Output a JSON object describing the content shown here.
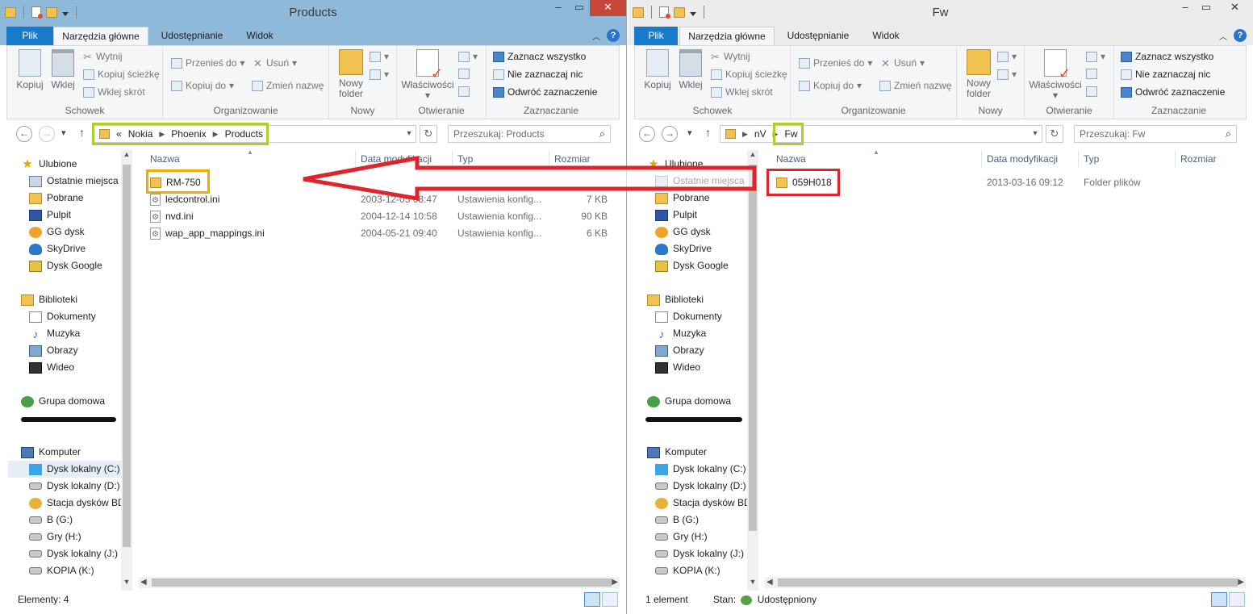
{
  "common": {
    "tabs": {
      "file": "Plik",
      "home": "Narzędzia główne",
      "share": "Udostępnianie",
      "view": "Widok"
    },
    "ribbon": {
      "clipboard": {
        "copy": "Kopiuj",
        "paste": "Wklej",
        "cut": "Wytnij",
        "copy_path": "Kopiuj ścieżkę",
        "paste_shortcut": "Wklej skrót",
        "label": "Schowek"
      },
      "organize": {
        "move_to": "Przenieś do",
        "copy_to": "Kopiuj do",
        "delete": "Usuń",
        "rename": "Zmień nazwę",
        "label": "Organizowanie"
      },
      "new": {
        "new_folder_line1": "Nowy",
        "new_folder_line2": "folder",
        "label": "Nowy"
      },
      "open": {
        "properties": "Właściwości",
        "label": "Otwieranie"
      },
      "select": {
        "select_all": "Zaznacz wszystko",
        "select_none": "Nie zaznaczaj nic",
        "invert": "Odwróć zaznaczenie",
        "label": "Zaznaczanie"
      }
    },
    "columns": {
      "name": "Nazwa",
      "date": "Data modyfikacji",
      "type": "Typ",
      "size": "Rozmiar"
    },
    "nav": {
      "favorites": "Ulubione",
      "recent": "Ostatnie miejsca",
      "downloads": "Pobrane",
      "desktop": "Pulpit",
      "gg": "GG dysk",
      "skydrive": "SkyDrive",
      "gdrive": "Dysk Google",
      "libraries": "Biblioteki",
      "documents": "Dokumenty",
      "music": "Muzyka",
      "pictures": "Obrazy",
      "video": "Wideo",
      "homegroup": "Grupa domowa",
      "computer": "Komputer",
      "drive_c": "Dysk lokalny (C:)",
      "drive_d": "Dysk lokalny (D:)",
      "drive_bd": "Stacja dysków BD",
      "drive_g": "B (G:)",
      "drive_h": "Gry (H:)",
      "drive_j": "Dysk lokalny (J:)",
      "drive_k": "KOPIA (K:)"
    }
  },
  "left": {
    "title": "Products",
    "breadcrumb_prefix": "«",
    "breadcrumb": [
      "Nokia",
      "Phoenix",
      "Products"
    ],
    "search_placeholder": "Przeszukaj: Products",
    "files": [
      {
        "name": "RM-750",
        "date": "",
        "type": "",
        "size": "",
        "icon": "folder"
      },
      {
        "name": "ledcontrol.ini",
        "date": "2003-12-05 08:47",
        "type": "Ustawienia konfig...",
        "size": "7 KB",
        "icon": "ini"
      },
      {
        "name": "nvd.ini",
        "date": "2004-12-14 10:58",
        "type": "Ustawienia konfig...",
        "size": "90 KB",
        "icon": "ini"
      },
      {
        "name": "wap_app_mappings.ini",
        "date": "2004-05-21 09:40",
        "type": "Ustawienia konfig...",
        "size": "6 KB",
        "icon": "ini"
      }
    ],
    "status": "Elementy: 4"
  },
  "right": {
    "title": "Fw",
    "breadcrumb": [
      "nV",
      "Fw"
    ],
    "search_placeholder": "Przeszukaj: Fw",
    "files": [
      {
        "name": "059H018",
        "date": "2013-03-16 09:12",
        "type": "Folder plików",
        "size": "",
        "icon": "folder"
      }
    ],
    "status_count": "1 element",
    "status_state_label": "Stan:",
    "status_state_value": "Udostępniony"
  },
  "annotation": {
    "arrow_color": "#e0242b",
    "green_color": "#a8d12c",
    "orange_color": "#f2a900"
  }
}
